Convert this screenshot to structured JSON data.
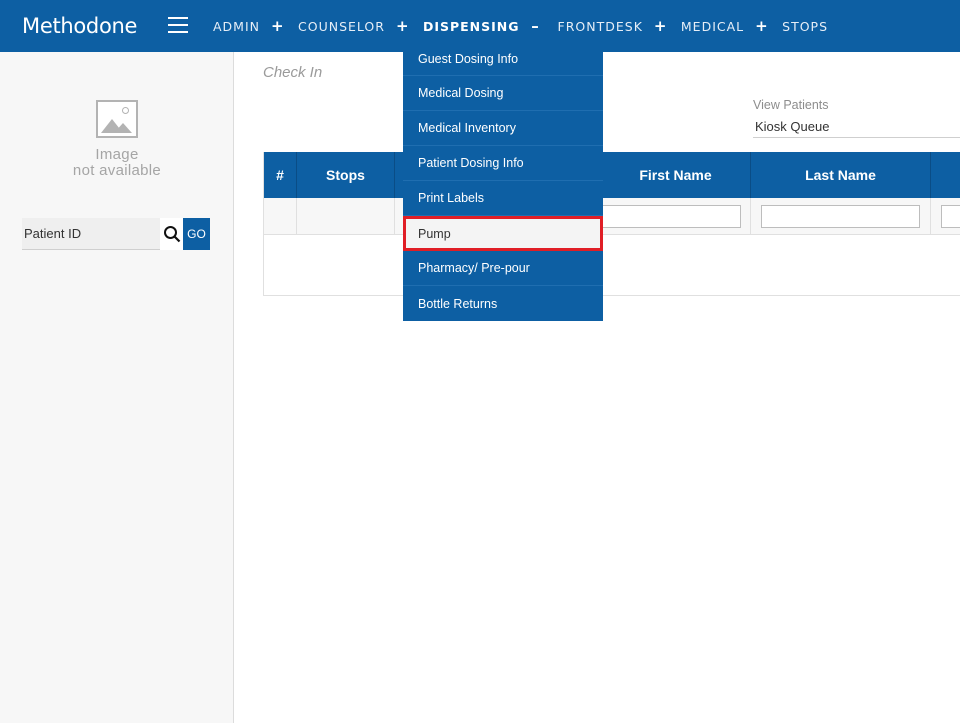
{
  "app": {
    "logo_text": "Methodone"
  },
  "nav": {
    "items": [
      {
        "label": "ADMIN",
        "toggle": "+"
      },
      {
        "label": "COUNSELOR",
        "toggle": "+"
      },
      {
        "label": "DISPENSING",
        "toggle": "–"
      },
      {
        "label": "FRONTDESK",
        "toggle": "+"
      },
      {
        "label": "MEDICAL",
        "toggle": "+"
      },
      {
        "label": "STOPS",
        "toggle": ""
      }
    ]
  },
  "dropdown": {
    "items": [
      "Guest Dosing Info",
      "Medical Dosing",
      "Medical Inventory",
      "Patient Dosing Info",
      "Print Labels",
      "Pump",
      "Pharmacy/ Pre-pour",
      "Bottle Returns"
    ],
    "highlighted": "Pump"
  },
  "sidebar": {
    "avatar_line1": "Image",
    "avatar_line2": "not available",
    "patient_id_placeholder": "Patient ID",
    "go_label": "GO"
  },
  "main": {
    "title": "Check In",
    "view_patients_label": "View Patients",
    "view_patients_value": "Kiosk Queue",
    "table": {
      "headers": [
        "#",
        "Stops",
        "",
        "First Name",
        "Last Name",
        ""
      ]
    }
  },
  "colors": {
    "primary": "#0d5fa3",
    "highlight_border": "#e01e26",
    "logo_accent": "#f08a24"
  },
  "icons": {
    "search": "search-icon",
    "menu": "hamburger-icon",
    "avatar": "image-placeholder-icon"
  }
}
